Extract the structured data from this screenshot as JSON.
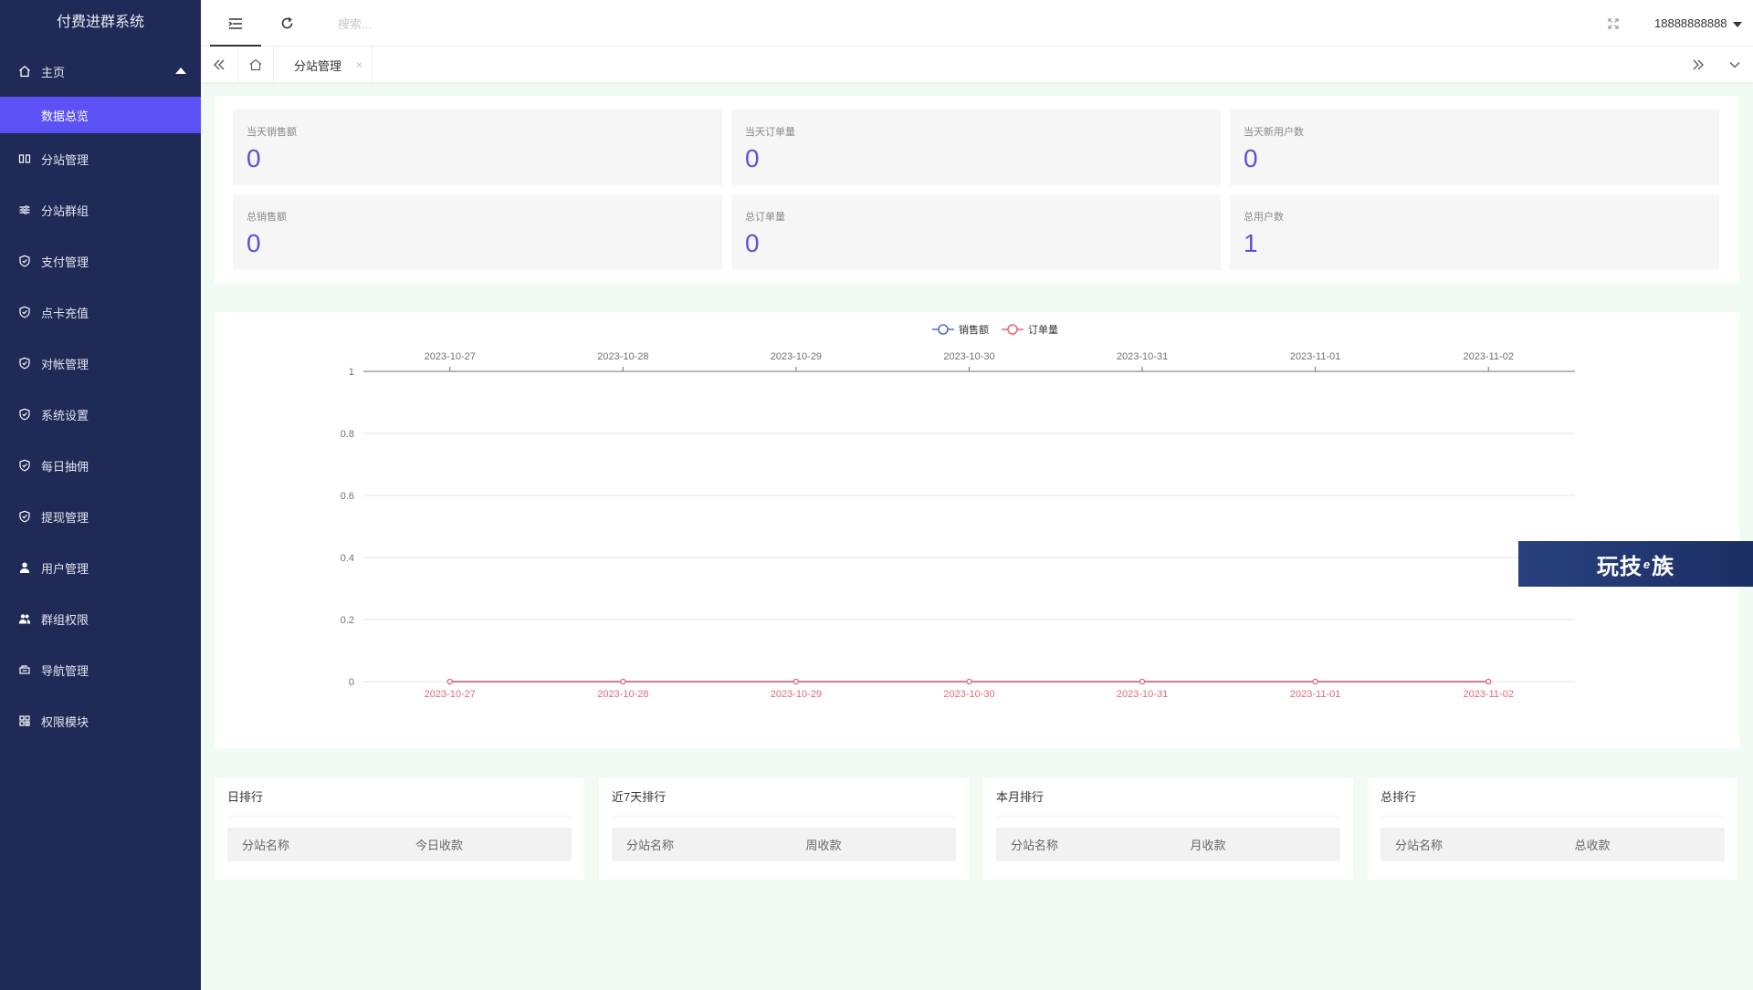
{
  "app": {
    "title": "付费进群系统"
  },
  "sidebar": {
    "home": {
      "label": "主页"
    },
    "active_sub": {
      "label": "数据总览"
    },
    "items": [
      {
        "label": "分站管理",
        "icon": "columns-icon"
      },
      {
        "label": "分站群组",
        "icon": "sliders-icon"
      },
      {
        "label": "支付管理",
        "icon": "shield-check-icon"
      },
      {
        "label": "点卡充值",
        "icon": "shield-check-icon"
      },
      {
        "label": "对帐管理",
        "icon": "shield-check-icon"
      },
      {
        "label": "系统设置",
        "icon": "shield-check-icon"
      },
      {
        "label": "每日抽佣",
        "icon": "shield-check-icon"
      },
      {
        "label": "提现管理",
        "icon": "shield-check-icon"
      },
      {
        "label": "用户管理",
        "icon": "user-icon"
      },
      {
        "label": "群组权限",
        "icon": "users-icon"
      },
      {
        "label": "导航管理",
        "icon": "nav-icon"
      },
      {
        "label": "权限模块",
        "icon": "grid-icon"
      }
    ]
  },
  "header": {
    "search_placeholder": "搜索...",
    "username": "18888888888"
  },
  "tabs": {
    "current": "分站管理",
    "close": "×"
  },
  "stats": [
    {
      "label": "当天销售额",
      "value": "0"
    },
    {
      "label": "当天订单量",
      "value": "0"
    },
    {
      "label": "当天新用户数",
      "value": "0"
    },
    {
      "label": "总销售额",
      "value": "0"
    },
    {
      "label": "总订单量",
      "value": "0"
    },
    {
      "label": "总用户数",
      "value": "1"
    }
  ],
  "chart_data": {
    "type": "line",
    "x": [
      "2023-10-27",
      "2023-10-28",
      "2023-10-29",
      "2023-10-30",
      "2023-10-31",
      "2023-11-01",
      "2023-11-02"
    ],
    "series": [
      {
        "name": "销售额",
        "values": [
          0,
          0,
          0,
          0,
          0,
          0,
          0
        ],
        "color": "#5470c6"
      },
      {
        "name": "订单量",
        "values": [
          0,
          0,
          0,
          0,
          0,
          0,
          0
        ],
        "color": "#e06a7a"
      }
    ],
    "ylim": [
      0,
      1
    ],
    "yticks": [
      "0",
      "0.2",
      "0.4",
      "0.6",
      "0.8",
      "1"
    ],
    "legend": "top-center",
    "grid": true
  },
  "rankings": [
    {
      "title": "日排行",
      "col1": "分站名称",
      "col2": "今日收款"
    },
    {
      "title": "近7天排行",
      "col1": "分站名称",
      "col2": "周收款"
    },
    {
      "title": "本月排行",
      "col1": "分站名称",
      "col2": "月收款"
    },
    {
      "title": "总排行",
      "col1": "分站名称",
      "col2": "总收款"
    }
  ],
  "watermark": {
    "part1": "玩技",
    "part2": "e",
    "part3": "族"
  }
}
